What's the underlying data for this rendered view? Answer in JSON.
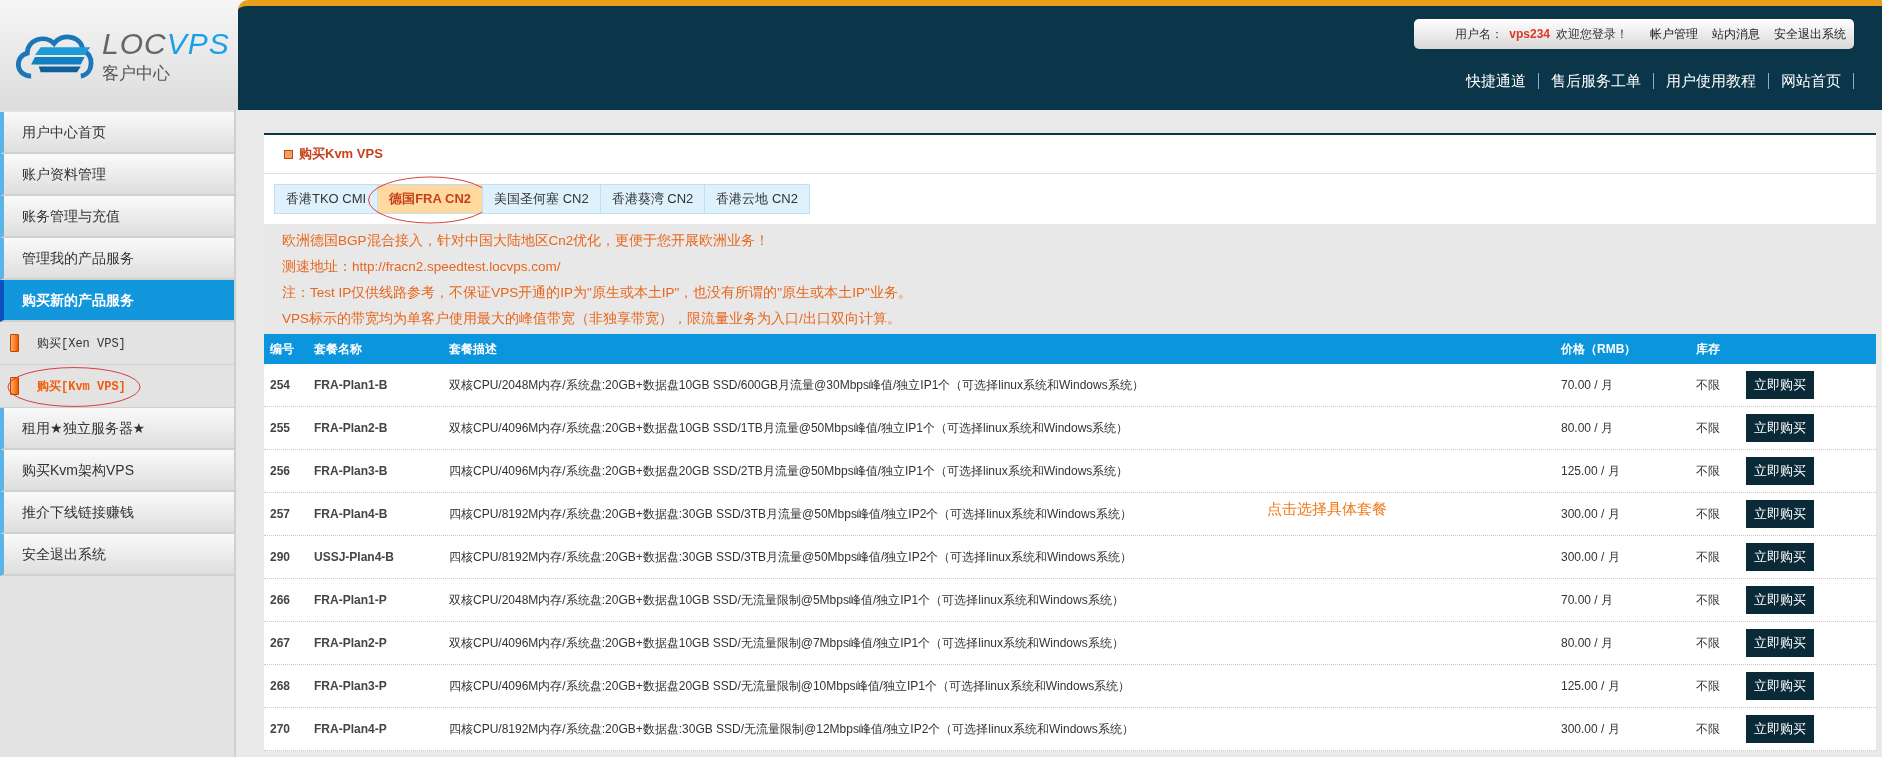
{
  "logo": {
    "brand_left": "LOC",
    "brand_right": "VPS",
    "subtitle": "客户中心"
  },
  "user_bar": {
    "username_label": "用户名：",
    "username": "vps234",
    "welcome": "欢迎您登录！",
    "links": [
      "帐户管理",
      "站内消息",
      "安全退出系统"
    ]
  },
  "top_nav": [
    "快捷通道",
    "售后服务工单",
    "用户使用教程",
    "网站首页"
  ],
  "sidebar": {
    "items": [
      {
        "label": "用户中心首页",
        "kind": "main",
        "selected": false,
        "circled": false
      },
      {
        "label": "账户资料管理",
        "kind": "main",
        "selected": false,
        "circled": false
      },
      {
        "label": "账务管理与充值",
        "kind": "main",
        "selected": false,
        "circled": false
      },
      {
        "label": "管理我的产品服务",
        "kind": "main",
        "selected": false,
        "circled": false
      },
      {
        "label": "购买新的产品服务",
        "kind": "main",
        "selected": true,
        "circled": false
      },
      {
        "label": "购买[Xen VPS]",
        "kind": "sub",
        "selected": false,
        "circled": false
      },
      {
        "label": "购买[Kvm VPS]",
        "kind": "sub",
        "selected": true,
        "circled": true
      },
      {
        "label": "租用★独立服务器★",
        "kind": "main",
        "selected": false,
        "circled": false
      },
      {
        "label": "购买Kvm架构VPS",
        "kind": "main",
        "selected": false,
        "circled": false
      },
      {
        "label": "推介下线链接赚钱",
        "kind": "main",
        "selected": false,
        "circled": false
      },
      {
        "label": "安全退出系统",
        "kind": "main",
        "selected": false,
        "circled": false
      }
    ]
  },
  "panel": {
    "title": "购买Kvm VPS",
    "tabs": [
      {
        "label": "香港TKO CMI",
        "selected": false,
        "circled": false
      },
      {
        "label": "德国FRA CN2",
        "selected": true,
        "circled": true
      },
      {
        "label": "美国圣何塞 CN2",
        "selected": false,
        "circled": false
      },
      {
        "label": "香港葵湾 CN2",
        "selected": false,
        "circled": false
      },
      {
        "label": "香港云地 CN2",
        "selected": false,
        "circled": false
      }
    ],
    "notices": [
      "欧洲德国BGP混合接入，针对中国大陆地区Cn2优化，更便于您开展欧洲业务！",
      "测速地址：http://fracn2.speedtest.locvps.com/",
      "注：Test IP仅供线路参考，不保证VPS开通的IP为\"原生或本土IP\"，也没有所谓的\"原生或本土IP\"业务。",
      "VPS标示的带宽均为单客户使用最大的峰值带宽（非独享带宽），限流量业务为入口/出口双向计算。"
    ],
    "table": {
      "columns": [
        "编号",
        "套餐名称",
        "套餐描述",
        "价格（RMB）",
        "库存"
      ],
      "rows": [
        {
          "id": "254",
          "name": "FRA-Plan1-B",
          "description": "双核CPU/2048M内存/系统盘:20GB+数据盘10GB SSD/600GB月流量@30Mbps峰值/独立IP1个（可选择linux系统和Windows系统）",
          "price": "70.00 / 月",
          "stock": "不限",
          "action": "立即购买"
        },
        {
          "id": "255",
          "name": "FRA-Plan2-B",
          "description": "双核CPU/4096M内存/系统盘:20GB+数据盘10GB SSD/1TB月流量@50Mbps峰值/独立IP1个（可选择linux系统和Windows系统）",
          "price": "80.00 / 月",
          "stock": "不限",
          "action": "立即购买"
        },
        {
          "id": "256",
          "name": "FRA-Plan3-B",
          "description": "四核CPU/4096M内存/系统盘:20GB+数据盘20GB SSD/2TB月流量@50Mbps峰值/独立IP1个（可选择linux系统和Windows系统）",
          "price": "125.00 / 月",
          "stock": "不限",
          "action": "立即购买"
        },
        {
          "id": "257",
          "name": "FRA-Plan4-B",
          "description": "四核CPU/8192M内存/系统盘:20GB+数据盘:30GB SSD/3TB月流量@50Mbps峰值/独立IP2个（可选择linux系统和Windows系统）",
          "price": "300.00 / 月",
          "stock": "不限",
          "action": "立即购买"
        },
        {
          "id": "290",
          "name": "USSJ-Plan4-B",
          "description": "四核CPU/8192M内存/系统盘:20GB+数据盘:30GB SSD/3TB月流量@50Mbps峰值/独立IP2个（可选择linux系统和Windows系统）",
          "price": "300.00 / 月",
          "stock": "不限",
          "action": "立即购买"
        },
        {
          "id": "266",
          "name": "FRA-Plan1-P",
          "description": "双核CPU/2048M内存/系统盘:20GB+数据盘10GB SSD/无流量限制@5Mbps峰值/独立IP1个（可选择linux系统和Windows系统）",
          "price": "70.00 / 月",
          "stock": "不限",
          "action": "立即购买"
        },
        {
          "id": "267",
          "name": "FRA-Plan2-P",
          "description": "双核CPU/4096M内存/系统盘:20GB+数据盘10GB SSD/无流量限制@7Mbps峰值/独立IP1个（可选择linux系统和Windows系统）",
          "price": "80.00 / 月",
          "stock": "不限",
          "action": "立即购买"
        },
        {
          "id": "268",
          "name": "FRA-Plan3-P",
          "description": "四核CPU/4096M内存/系统盘:20GB+数据盘20GB SSD/无流量限制@10Mbps峰值/独立IP1个（可选择linux系统和Windows系统）",
          "price": "125.00 / 月",
          "stock": "不限",
          "action": "立即购买"
        },
        {
          "id": "270",
          "name": "FRA-Plan4-P",
          "description": "四核CPU/8192M内存/系统盘:20GB+数据盘:30GB SSD/无流量限制@12Mbps峰值/独立IP2个（可选择linux系统和Windows系统）",
          "price": "300.00 / 月",
          "stock": "不限",
          "action": "立即购买"
        }
      ]
    },
    "annotation": "点击选择具体套餐"
  }
}
